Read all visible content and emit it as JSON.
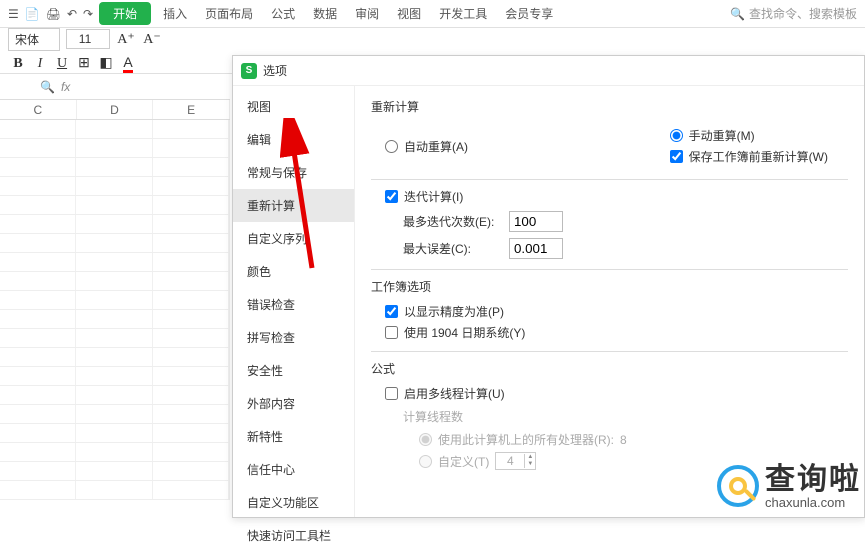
{
  "tabs": {
    "start": "开始",
    "insert": "插入",
    "page_layout": "页面布局",
    "formula": "公式",
    "data": "数据",
    "review": "审阅",
    "view": "视图",
    "dev_tools": "开发工具",
    "member": "会员专享"
  },
  "search_placeholder": "查找命令、搜索模板",
  "font": {
    "name": "宋体",
    "size": "11"
  },
  "cols": [
    "C",
    "D",
    "E"
  ],
  "dialog": {
    "title": "选项",
    "nav": {
      "view": "视图",
      "edit": "编辑",
      "general_save": "常规与保存",
      "recalc": "重新计算",
      "custom_seq": "自定义序列",
      "color": "颜色",
      "error_check": "错误检查",
      "spell_check": "拼写检查",
      "security": "安全性",
      "external": "外部内容",
      "new_features": "新特性",
      "trust_center": "信任中心",
      "custom_ribbon": "自定义功能区",
      "quick_access": "快速访问工具栏"
    },
    "content": {
      "recalc_title": "重新计算",
      "auto_recalc": "自动重算(A)",
      "manual_recalc": "手动重算(M)",
      "save_recalc": "保存工作簿前重新计算(W)",
      "iter_calc": "迭代计算(I)",
      "max_iter_label": "最多迭代次数(E):",
      "max_iter_value": "100",
      "max_error_label": "最大误差(C):",
      "max_error_value": "0.001",
      "workbook_title": "工作簿选项",
      "precision_display": "以显示精度为准(P)",
      "date_1904": "使用 1904 日期系统(Y)",
      "formula_title": "公式",
      "multi_thread": "启用多线程计算(U)",
      "thread_count_title": "计算线程数",
      "use_all_cpu": "使用此计算机上的所有处理器(R):",
      "cpu_count": "8",
      "custom_label": "自定义(T)",
      "custom_value": "4"
    }
  },
  "watermark": {
    "big": "查询啦",
    "small": "chaxunla.com"
  },
  "formula_fx": "fx"
}
